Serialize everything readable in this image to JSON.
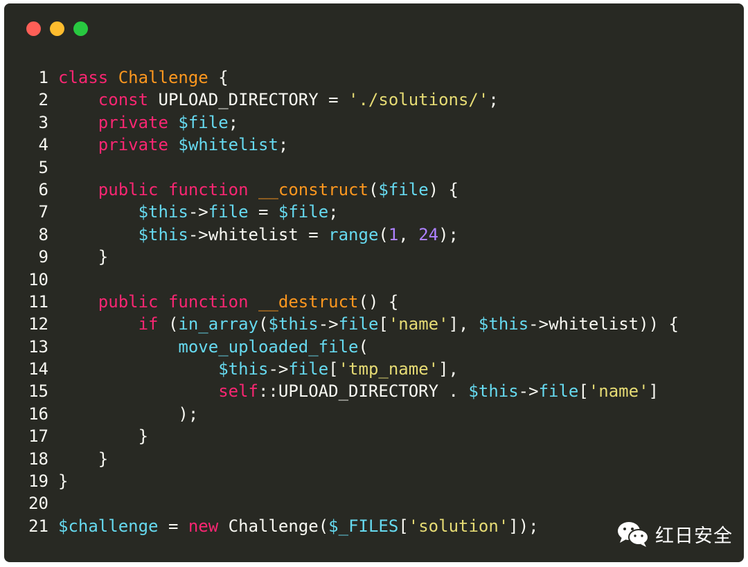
{
  "colors": {
    "background": "#282923",
    "keyword": "#f92672",
    "function": "#fd971f",
    "variable": "#66d9ef",
    "string": "#e6db74",
    "number": "#ae81ff",
    "plain": "#f8f8f2",
    "traffic_red": "#fe5f57",
    "traffic_yellow": "#febc2e",
    "traffic_green": "#28c840"
  },
  "window": {
    "controls": [
      "close-dot",
      "minimize-dot",
      "maximize-dot"
    ]
  },
  "code_lines": [
    {
      "n": "1",
      "tokens": [
        [
          "k",
          "class"
        ],
        [
          "p",
          " "
        ],
        [
          "f",
          "Challenge"
        ],
        [
          "p",
          " {"
        ]
      ]
    },
    {
      "n": "2",
      "tokens": [
        [
          "p",
          "    "
        ],
        [
          "k",
          "const"
        ],
        [
          "p",
          " UPLOAD_DIRECTORY = "
        ],
        [
          "s",
          "'./solutions/'"
        ],
        [
          "p",
          ";"
        ]
      ]
    },
    {
      "n": "3",
      "tokens": [
        [
          "p",
          "    "
        ],
        [
          "k",
          "private"
        ],
        [
          "p",
          " "
        ],
        [
          "v",
          "$file"
        ],
        [
          "p",
          ";"
        ]
      ]
    },
    {
      "n": "4",
      "tokens": [
        [
          "p",
          "    "
        ],
        [
          "k",
          "private"
        ],
        [
          "p",
          " "
        ],
        [
          "v",
          "$whitelist"
        ],
        [
          "p",
          ";"
        ]
      ]
    },
    {
      "n": "5",
      "tokens": []
    },
    {
      "n": "6",
      "tokens": [
        [
          "p",
          "    "
        ],
        [
          "k",
          "public"
        ],
        [
          "p",
          " "
        ],
        [
          "k",
          "function"
        ],
        [
          "p",
          " "
        ],
        [
          "f",
          "__construct"
        ],
        [
          "p",
          "("
        ],
        [
          "v",
          "$file"
        ],
        [
          "p",
          ") {"
        ]
      ]
    },
    {
      "n": "7",
      "tokens": [
        [
          "p",
          "        "
        ],
        [
          "v",
          "$this"
        ],
        [
          "p",
          "->"
        ],
        [
          "v",
          "file"
        ],
        [
          "p",
          " = "
        ],
        [
          "v",
          "$file"
        ],
        [
          "p",
          ";"
        ]
      ]
    },
    {
      "n": "8",
      "tokens": [
        [
          "p",
          "        "
        ],
        [
          "v",
          "$this"
        ],
        [
          "p",
          "->whitelist = "
        ],
        [
          "v",
          "range"
        ],
        [
          "p",
          "("
        ],
        [
          "n",
          "1"
        ],
        [
          "p",
          ", "
        ],
        [
          "n",
          "24"
        ],
        [
          "p",
          ");"
        ]
      ]
    },
    {
      "n": "9",
      "tokens": [
        [
          "p",
          "    }"
        ]
      ]
    },
    {
      "n": "10",
      "tokens": []
    },
    {
      "n": "11",
      "tokens": [
        [
          "p",
          "    "
        ],
        [
          "k",
          "public"
        ],
        [
          "p",
          " "
        ],
        [
          "k",
          "function"
        ],
        [
          "p",
          " "
        ],
        [
          "f",
          "__destruct"
        ],
        [
          "p",
          "() {"
        ]
      ]
    },
    {
      "n": "12",
      "tokens": [
        [
          "p",
          "        "
        ],
        [
          "k",
          "if"
        ],
        [
          "p",
          " ("
        ],
        [
          "v",
          "in_array"
        ],
        [
          "p",
          "("
        ],
        [
          "v",
          "$this"
        ],
        [
          "p",
          "->"
        ],
        [
          "v",
          "file"
        ],
        [
          "p",
          "["
        ],
        [
          "s",
          "'name'"
        ],
        [
          "p",
          "], "
        ],
        [
          "v",
          "$this"
        ],
        [
          "p",
          "->whitelist)) {"
        ]
      ]
    },
    {
      "n": "13",
      "tokens": [
        [
          "p",
          "            "
        ],
        [
          "v",
          "move_uploaded_file"
        ],
        [
          "p",
          "("
        ]
      ]
    },
    {
      "n": "14",
      "tokens": [
        [
          "p",
          "                "
        ],
        [
          "v",
          "$this"
        ],
        [
          "p",
          "->"
        ],
        [
          "v",
          "file"
        ],
        [
          "p",
          "["
        ],
        [
          "s",
          "'tmp_name'"
        ],
        [
          "p",
          "],"
        ]
      ]
    },
    {
      "n": "15",
      "tokens": [
        [
          "p",
          "                "
        ],
        [
          "k",
          "self"
        ],
        [
          "p",
          "::UPLOAD_DIRECTORY . "
        ],
        [
          "v",
          "$this"
        ],
        [
          "p",
          "->"
        ],
        [
          "v",
          "file"
        ],
        [
          "p",
          "["
        ],
        [
          "s",
          "'name'"
        ],
        [
          "p",
          "]"
        ]
      ]
    },
    {
      "n": "16",
      "tokens": [
        [
          "p",
          "            );"
        ]
      ]
    },
    {
      "n": "17",
      "tokens": [
        [
          "p",
          "        }"
        ]
      ]
    },
    {
      "n": "18",
      "tokens": [
        [
          "p",
          "    }"
        ]
      ]
    },
    {
      "n": "19",
      "tokens": [
        [
          "p",
          "}"
        ]
      ]
    },
    {
      "n": "20",
      "tokens": []
    },
    {
      "n": "21",
      "tokens": [
        [
          "v",
          "$challenge"
        ],
        [
          "p",
          " = "
        ],
        [
          "k",
          "new"
        ],
        [
          "p",
          " Challenge("
        ],
        [
          "v",
          "$_FILES"
        ],
        [
          "p",
          "["
        ],
        [
          "s",
          "'solution'"
        ],
        [
          "p",
          "]);"
        ]
      ]
    }
  ],
  "watermark": {
    "icon": "wechat-icon",
    "text": "红日安全"
  }
}
